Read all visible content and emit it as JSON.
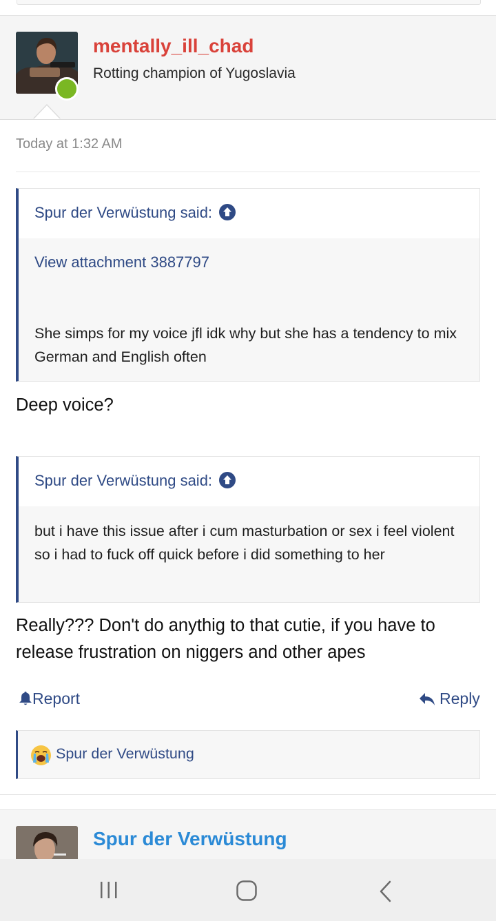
{
  "post": {
    "username": "mentally_ill_chad",
    "user_title": "Rotting champion of Yugoslavia",
    "timestamp": "Today at 1:32 AM",
    "quotes": [
      {
        "attribution": "Spur der Verwüstung said:",
        "attachment_link": "View attachment 3887797",
        "body": "She simps for my voice jfl idk why but she has a tendency to mix German and English often"
      },
      {
        "attribution": "Spur der Verwüstung said:",
        "body": "but i have this issue after i cum masturbation or sex i feel violent so i had to fuck off quick before i did something to her"
      }
    ],
    "replies": [
      "Deep voice?",
      "Really??? Don't do anythig to that cutie, if you have to release frustration on niggers and other apes"
    ],
    "actions": {
      "report_label": "Report",
      "reply_label": "Reply"
    },
    "reaction": {
      "emoji": "loudly-crying-face",
      "user": "Spur der Verwüstung"
    }
  },
  "next_post": {
    "username": "Spur der Verwüstung"
  },
  "icons": {
    "online": "online-status-dot",
    "quote_jump": "arrow-up-circle-icon",
    "report": "bell-icon",
    "reply": "reply-arrow-icon"
  },
  "colors": {
    "username_main": "#d9423a",
    "username_next": "#2b8ad6",
    "link": "#2f4a85",
    "online": "#7ab723"
  },
  "system_nav": {
    "recents": "recent-apps-icon",
    "home": "home-icon",
    "back": "back-icon"
  }
}
